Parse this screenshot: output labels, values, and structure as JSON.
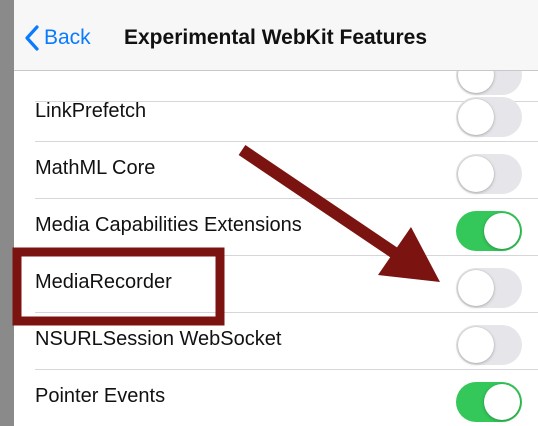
{
  "nav": {
    "back_label": "Back",
    "title": "Experimental WebKit Features"
  },
  "rows": [
    {
      "label": "",
      "on": false,
      "partial": true
    },
    {
      "label": "LinkPrefetch",
      "on": false
    },
    {
      "label": "MathML Core",
      "on": false
    },
    {
      "label": "Media Capabilities Extensions",
      "on": true
    },
    {
      "label": "MediaRecorder",
      "on": false
    },
    {
      "label": "NSURLSession WebSocket",
      "on": false
    },
    {
      "label": "Pointer Events",
      "on": true
    }
  ],
  "colors": {
    "accent": "#0a7aff",
    "toggle_on": "#34c759",
    "toggle_off": "#e6e6ea",
    "annotation": "#7b1410"
  }
}
